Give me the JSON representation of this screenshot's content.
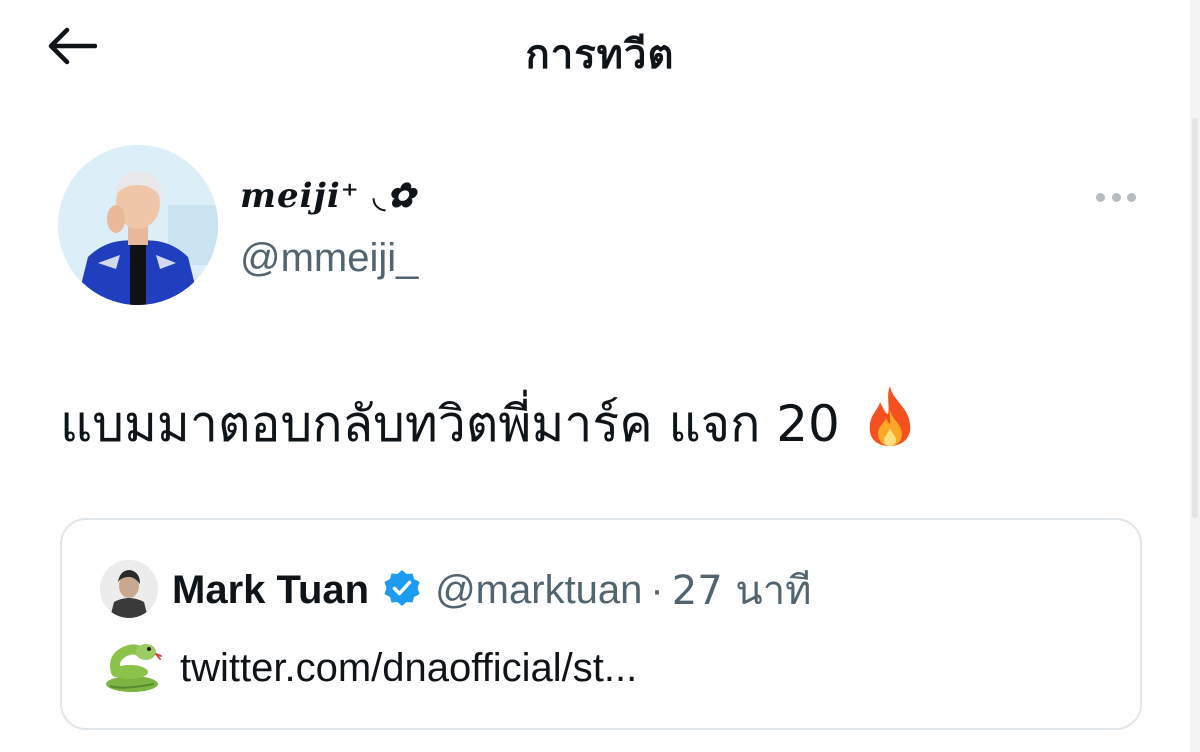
{
  "header": {
    "title": "การทวีต"
  },
  "tweet": {
    "author": {
      "display_name": "meiji⁺ ◟✿",
      "handle": "@mmeiji_"
    },
    "text": "แบมมาตอบกลับทวิตพี่มาร์ค แจก 20",
    "emoji": "fire-emoji"
  },
  "quoted_tweet": {
    "display_name": "Mark Tuan",
    "verified": true,
    "handle": "@marktuan",
    "separator": "·",
    "time": "27 นาที",
    "emoji": "snake-emoji",
    "link_text": "twitter.com/dnaofficial/st..."
  },
  "colors": {
    "primary_text": "#0f1419",
    "secondary_text": "#536471",
    "verified_blue": "#1d9bf0",
    "border": "#e1e6ea"
  }
}
